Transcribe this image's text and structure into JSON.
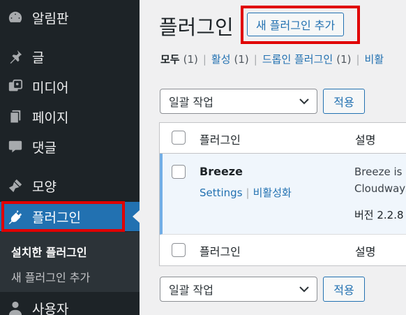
{
  "sidebar": {
    "items": [
      {
        "label": "알림판",
        "icon": "dashboard-icon"
      },
      {
        "label": "글",
        "icon": "pin-icon"
      },
      {
        "label": "미디어",
        "icon": "media-icon"
      },
      {
        "label": "페이지",
        "icon": "pages-icon"
      },
      {
        "label": "댓글",
        "icon": "comment-icon"
      },
      {
        "label": "모양",
        "icon": "appearance-icon"
      },
      {
        "label": "플러그인",
        "icon": "plugin-icon"
      },
      {
        "label": "사용자",
        "icon": "user-icon"
      }
    ],
    "active_index": 6,
    "submenu": {
      "installed": "설치한 플러그인",
      "add_new": "새 플러그인 추가"
    }
  },
  "main": {
    "title": "플러그인",
    "add_new_button": "새 플러그인 추가",
    "filters": {
      "all": "모두",
      "all_count": "(1)",
      "active": "활성",
      "active_count": "(1)",
      "dropin": "드롭인 플러그인",
      "dropin_count": "(1)",
      "inactive": "비활"
    },
    "bulk_actions": "일괄 작업",
    "apply": "적용",
    "table": {
      "col_plugin": "플러그인",
      "col_description": "설명",
      "plugin": {
        "name": "Breeze",
        "action_settings": "Settings",
        "action_deactivate": "비활성화",
        "desc_line1": "Breeze is a",
        "desc_line2": "Cloudways",
        "version": "버전 2.2.8"
      }
    }
  },
  "colors": {
    "sidebar_bg": "#1d2327",
    "accent": "#2271b1",
    "highlight": "#e00000"
  }
}
